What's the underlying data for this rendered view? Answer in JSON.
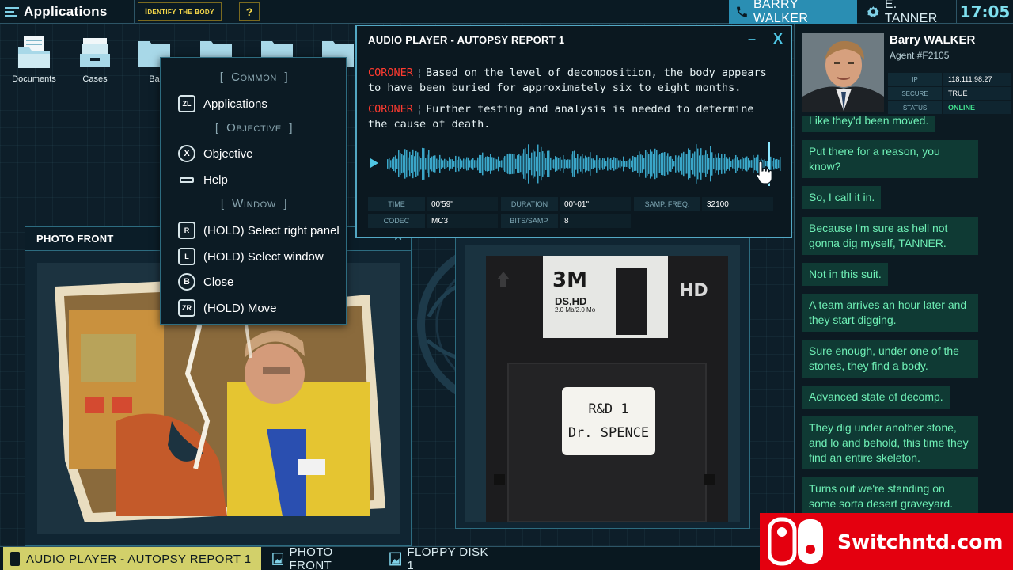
{
  "topbar": {
    "apps_label": "Applications",
    "task_label": "Identify the body",
    "help_label": "?",
    "contact_active": "BARRY WALKER",
    "contact_other": "E. TANNER",
    "clock": "17:05"
  },
  "desktop": {
    "icons": [
      {
        "label": "Documents"
      },
      {
        "label": "Cases"
      },
      {
        "label": "Ba"
      }
    ]
  },
  "context_menu": {
    "sections": [
      "Common",
      "Objective",
      "Window"
    ],
    "items": [
      {
        "button": "ZL",
        "label": "Applications"
      },
      {
        "button": "X",
        "label": "Objective"
      },
      {
        "button": "-",
        "label": "Help"
      },
      {
        "button": "R",
        "label": "(HOLD) Select right panel"
      },
      {
        "button": "L",
        "label": "(HOLD) Select window"
      },
      {
        "button": "B",
        "label": "Close"
      },
      {
        "button": "ZR",
        "label": "(HOLD) Move"
      }
    ]
  },
  "audio_player": {
    "title": "AUDIO PLAYER - AUTOPSY REPORT 1",
    "lines": [
      {
        "speaker": "CORONER",
        "text": "Based on the level of decomposition, the body appears to have been buried for approximately six to eight months."
      },
      {
        "speaker": "CORONER",
        "text": "Further testing and analysis is needed to determine the cause of death."
      }
    ],
    "playback_progress": 0.97,
    "stats": {
      "time_label": "TIME",
      "time": "00'59''",
      "duration_label": "DURATION",
      "duration": "00'-01\"",
      "samp_freq_label": "SAMP. FREQ.",
      "samp_freq": "32100",
      "codec_label": "CODEC",
      "codec": "MC3",
      "bits_label": "BITS/SAMP.",
      "bits": "8"
    }
  },
  "photo_window": {
    "title": "PHOTO FRONT"
  },
  "floppy": {
    "brand": "3M",
    "type_line1": "DS,HD",
    "type_line2": "2.0 Mb/2.0 Mo",
    "hd_mark": "HD",
    "label_line1": "R&D 1",
    "label_line2": "Dr. SPENCE"
  },
  "agent": {
    "name": "Barry WALKER",
    "agent_id": "Agent #F2105",
    "ip_label": "IP",
    "ip": "118.111.98.27",
    "secure_label": "SECURE",
    "secure": "TRUE",
    "status_label": "STATUS",
    "status": "ONLINE"
  },
  "chat": {
    "messages": [
      "Like they'd been moved.",
      "Put there for a reason, you know?",
      "So, I call it in.",
      "Because I'm sure as hell not gonna dig myself, TANNER.",
      "Not in this suit.",
      "A team arrives an hour later and they start digging.",
      "Sure enough, under one of the stones, they find a body.",
      "Advanced state of decomp.",
      "They dig under another stone, and lo and behold, this time they find an entire skeleton.",
      "Turns out we're standing on some sorta desert graveyard."
    ]
  },
  "taskbar": {
    "items": [
      {
        "label": "AUDIO PLAYER - AUTOPSY REPORT 1"
      },
      {
        "label": "PHOTO FRONT"
      },
      {
        "label": "FLOPPY DISK 1"
      }
    ]
  },
  "watermark": {
    "text": "Switchntd.com"
  },
  "colors": {
    "accent": "#2a8eb3",
    "speaker": "#ff3b30",
    "chat_text": "#6ff0b6",
    "chat_bg": "#0f3a34",
    "task_active": "#d2d06a",
    "watermark": "#e4000f"
  }
}
